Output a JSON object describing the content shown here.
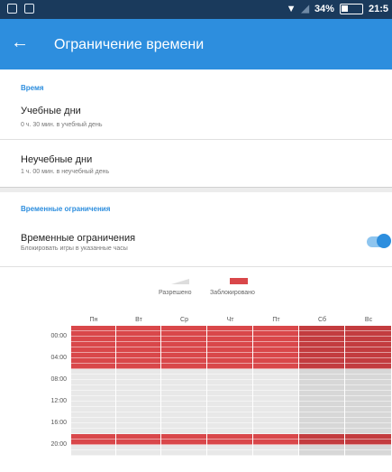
{
  "status_bar": {
    "battery_percent": "34%",
    "time": "21:5"
  },
  "app_bar": {
    "back_icon": "arrow-left-icon",
    "title": "Ограничение времени"
  },
  "time_section": {
    "header": "Время",
    "items": [
      {
        "title": "Учебные дни",
        "subtitle": "0 ч. 30 мин. в учебный день"
      },
      {
        "title": "Неучебные дни",
        "subtitle": "1 ч. 00 мин. в неучебный день"
      }
    ]
  },
  "restrictions_section": {
    "header": "Временные ограничения",
    "item_title": "Временные ограничения",
    "item_subtitle": "Блокировать игры в указанные часы",
    "toggle_on": true
  },
  "legend": {
    "allowed": "Разрешено",
    "blocked": "Заблокировано"
  },
  "schedule": {
    "days": [
      "Пн",
      "Вт",
      "Ср",
      "Чт",
      "Пт",
      "Сб",
      "Вс"
    ],
    "time_labels": [
      "00:00",
      "04:00",
      "08:00",
      "12:00",
      "16:00",
      "20:00"
    ],
    "blocked_ranges": [
      [
        0,
        8
      ],
      [
        20,
        22
      ]
    ],
    "colors": {
      "blocked_weekday": "#d9474a",
      "blocked_weekend": "#c33c3f",
      "allowed_weekday": "#e8e8e8",
      "allowed_weekend": "#d7d7d7"
    }
  }
}
